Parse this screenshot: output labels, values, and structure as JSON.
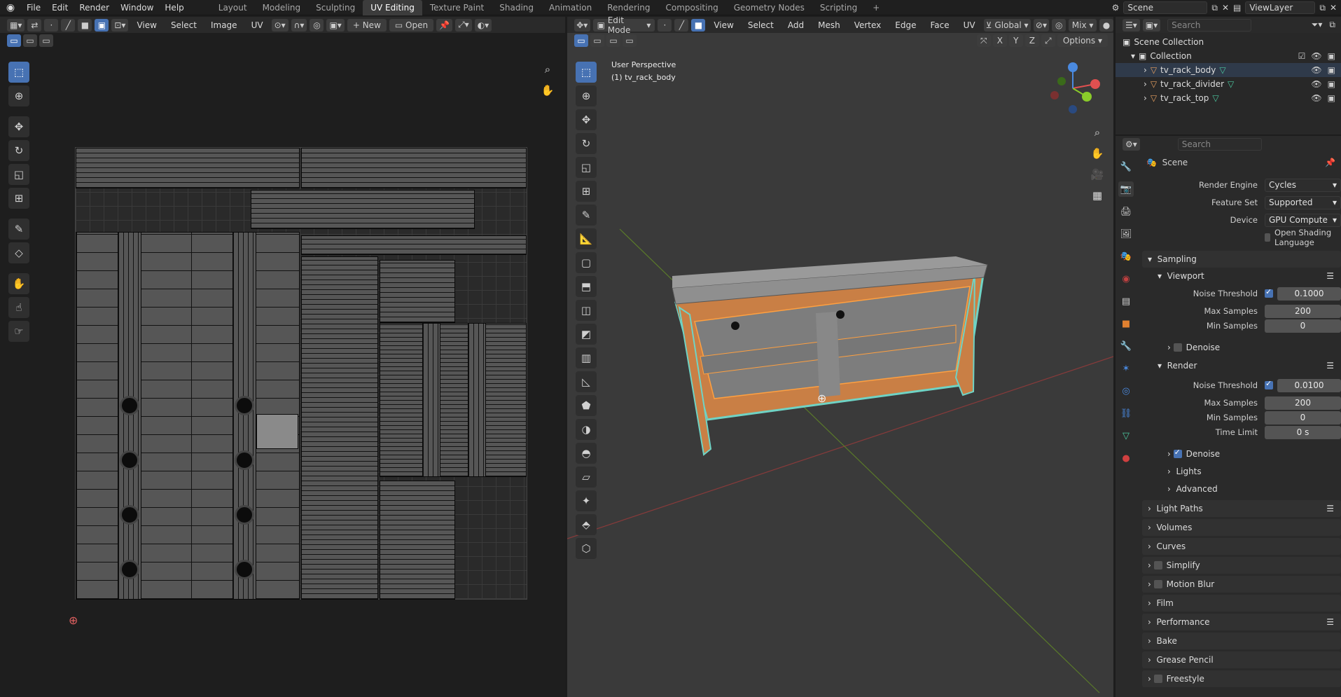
{
  "topbar": {
    "menus": [
      "File",
      "Edit",
      "Render",
      "Window",
      "Help"
    ],
    "workspaces": [
      "Layout",
      "Modeling",
      "Sculpting",
      "UV Editing",
      "Texture Paint",
      "Shading",
      "Animation",
      "Rendering",
      "Compositing",
      "Geometry Nodes",
      "Scripting"
    ],
    "active_workspace": "UV Editing",
    "scene": "Scene",
    "view_layer": "ViewLayer"
  },
  "uv_editor": {
    "menus": [
      "View",
      "Select",
      "Image",
      "UV"
    ],
    "new_label": "New",
    "open_label": "Open"
  },
  "viewport": {
    "mode": "Edit Mode",
    "menus": [
      "View",
      "Select",
      "Add",
      "Mesh",
      "Vertex",
      "Edge",
      "Face",
      "UV"
    ],
    "orientation": "Global",
    "shading": "Mix",
    "options": "Options",
    "axes": [
      "X",
      "Y",
      "Z"
    ],
    "view_name": "User Perspective",
    "object_label": "(1) tv_rack_body"
  },
  "outliner": {
    "search_placeholder": "Search",
    "scene_collection": "Scene Collection",
    "collection": "Collection",
    "objects": [
      "tv_rack_body",
      "tv_rack_divider",
      "tv_rack_top"
    ]
  },
  "properties": {
    "search_placeholder": "Search",
    "context": "Scene",
    "render_engine": {
      "label": "Render Engine",
      "value": "Cycles"
    },
    "feature_set": {
      "label": "Feature Set",
      "value": "Supported"
    },
    "device": {
      "label": "Device",
      "value": "GPU Compute"
    },
    "osl": "Open Shading Language",
    "sampling": "Sampling",
    "viewport": {
      "title": "Viewport",
      "noise_label": "Noise Threshold",
      "noise": "0.1000",
      "max_label": "Max Samples",
      "max": "200",
      "min_label": "Min Samples",
      "min": "0",
      "denoise": "Denoise"
    },
    "render": {
      "title": "Render",
      "noise_label": "Noise Threshold",
      "noise": "0.0100",
      "max_label": "Max Samples",
      "max": "200",
      "min_label": "Min Samples",
      "min": "0",
      "time_label": "Time Limit",
      "time": "0 s",
      "denoise": "Denoise",
      "lights": "Lights",
      "advanced": "Advanced"
    },
    "sections": [
      "Light Paths",
      "Volumes",
      "Curves",
      "Simplify",
      "Motion Blur",
      "Film",
      "Performance",
      "Bake",
      "Grease Pencil",
      "Freestyle"
    ]
  }
}
